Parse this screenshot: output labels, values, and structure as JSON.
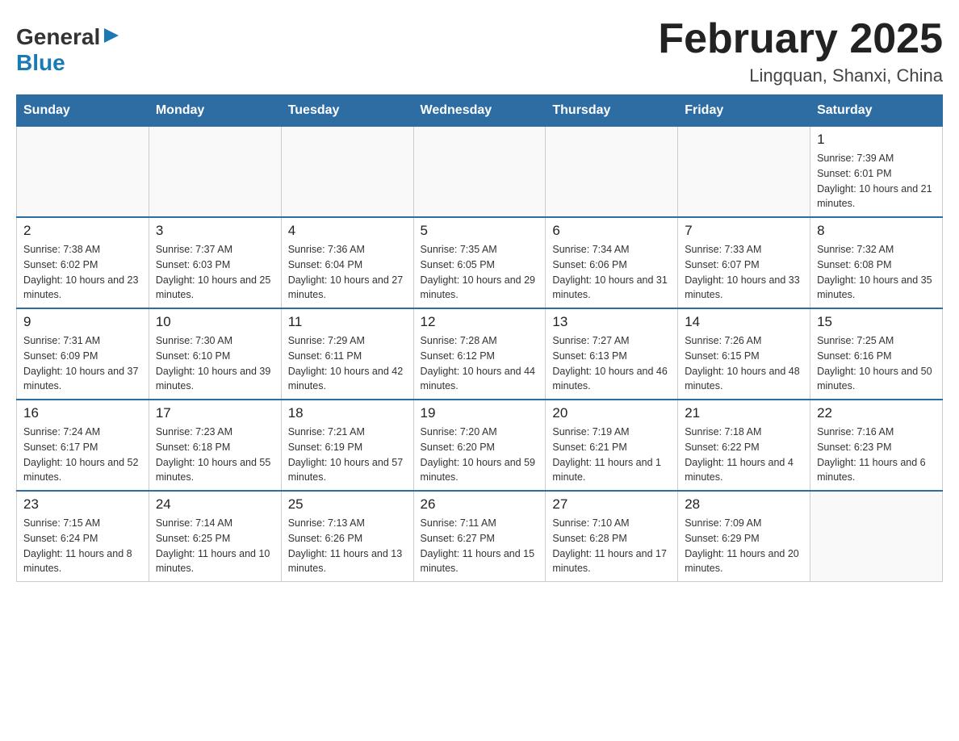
{
  "logo": {
    "general": "General",
    "blue": "Blue"
  },
  "title": {
    "month": "February 2025",
    "location": "Lingquan, Shanxi, China"
  },
  "days": {
    "headers": [
      "Sunday",
      "Monday",
      "Tuesday",
      "Wednesday",
      "Thursday",
      "Friday",
      "Saturday"
    ]
  },
  "weeks": [
    {
      "cells": [
        {
          "empty": true
        },
        {
          "empty": true
        },
        {
          "empty": true
        },
        {
          "empty": true
        },
        {
          "empty": true
        },
        {
          "empty": true
        },
        {
          "day": "1",
          "sunrise": "Sunrise: 7:39 AM",
          "sunset": "Sunset: 6:01 PM",
          "daylight": "Daylight: 10 hours and 21 minutes."
        }
      ]
    },
    {
      "cells": [
        {
          "day": "2",
          "sunrise": "Sunrise: 7:38 AM",
          "sunset": "Sunset: 6:02 PM",
          "daylight": "Daylight: 10 hours and 23 minutes."
        },
        {
          "day": "3",
          "sunrise": "Sunrise: 7:37 AM",
          "sunset": "Sunset: 6:03 PM",
          "daylight": "Daylight: 10 hours and 25 minutes."
        },
        {
          "day": "4",
          "sunrise": "Sunrise: 7:36 AM",
          "sunset": "Sunset: 6:04 PM",
          "daylight": "Daylight: 10 hours and 27 minutes."
        },
        {
          "day": "5",
          "sunrise": "Sunrise: 7:35 AM",
          "sunset": "Sunset: 6:05 PM",
          "daylight": "Daylight: 10 hours and 29 minutes."
        },
        {
          "day": "6",
          "sunrise": "Sunrise: 7:34 AM",
          "sunset": "Sunset: 6:06 PM",
          "daylight": "Daylight: 10 hours and 31 minutes."
        },
        {
          "day": "7",
          "sunrise": "Sunrise: 7:33 AM",
          "sunset": "Sunset: 6:07 PM",
          "daylight": "Daylight: 10 hours and 33 minutes."
        },
        {
          "day": "8",
          "sunrise": "Sunrise: 7:32 AM",
          "sunset": "Sunset: 6:08 PM",
          "daylight": "Daylight: 10 hours and 35 minutes."
        }
      ]
    },
    {
      "cells": [
        {
          "day": "9",
          "sunrise": "Sunrise: 7:31 AM",
          "sunset": "Sunset: 6:09 PM",
          "daylight": "Daylight: 10 hours and 37 minutes."
        },
        {
          "day": "10",
          "sunrise": "Sunrise: 7:30 AM",
          "sunset": "Sunset: 6:10 PM",
          "daylight": "Daylight: 10 hours and 39 minutes."
        },
        {
          "day": "11",
          "sunrise": "Sunrise: 7:29 AM",
          "sunset": "Sunset: 6:11 PM",
          "daylight": "Daylight: 10 hours and 42 minutes."
        },
        {
          "day": "12",
          "sunrise": "Sunrise: 7:28 AM",
          "sunset": "Sunset: 6:12 PM",
          "daylight": "Daylight: 10 hours and 44 minutes."
        },
        {
          "day": "13",
          "sunrise": "Sunrise: 7:27 AM",
          "sunset": "Sunset: 6:13 PM",
          "daylight": "Daylight: 10 hours and 46 minutes."
        },
        {
          "day": "14",
          "sunrise": "Sunrise: 7:26 AM",
          "sunset": "Sunset: 6:15 PM",
          "daylight": "Daylight: 10 hours and 48 minutes."
        },
        {
          "day": "15",
          "sunrise": "Sunrise: 7:25 AM",
          "sunset": "Sunset: 6:16 PM",
          "daylight": "Daylight: 10 hours and 50 minutes."
        }
      ]
    },
    {
      "cells": [
        {
          "day": "16",
          "sunrise": "Sunrise: 7:24 AM",
          "sunset": "Sunset: 6:17 PM",
          "daylight": "Daylight: 10 hours and 52 minutes."
        },
        {
          "day": "17",
          "sunrise": "Sunrise: 7:23 AM",
          "sunset": "Sunset: 6:18 PM",
          "daylight": "Daylight: 10 hours and 55 minutes."
        },
        {
          "day": "18",
          "sunrise": "Sunrise: 7:21 AM",
          "sunset": "Sunset: 6:19 PM",
          "daylight": "Daylight: 10 hours and 57 minutes."
        },
        {
          "day": "19",
          "sunrise": "Sunrise: 7:20 AM",
          "sunset": "Sunset: 6:20 PM",
          "daylight": "Daylight: 10 hours and 59 minutes."
        },
        {
          "day": "20",
          "sunrise": "Sunrise: 7:19 AM",
          "sunset": "Sunset: 6:21 PM",
          "daylight": "Daylight: 11 hours and 1 minute."
        },
        {
          "day": "21",
          "sunrise": "Sunrise: 7:18 AM",
          "sunset": "Sunset: 6:22 PM",
          "daylight": "Daylight: 11 hours and 4 minutes."
        },
        {
          "day": "22",
          "sunrise": "Sunrise: 7:16 AM",
          "sunset": "Sunset: 6:23 PM",
          "daylight": "Daylight: 11 hours and 6 minutes."
        }
      ]
    },
    {
      "cells": [
        {
          "day": "23",
          "sunrise": "Sunrise: 7:15 AM",
          "sunset": "Sunset: 6:24 PM",
          "daylight": "Daylight: 11 hours and 8 minutes."
        },
        {
          "day": "24",
          "sunrise": "Sunrise: 7:14 AM",
          "sunset": "Sunset: 6:25 PM",
          "daylight": "Daylight: 11 hours and 10 minutes."
        },
        {
          "day": "25",
          "sunrise": "Sunrise: 7:13 AM",
          "sunset": "Sunset: 6:26 PM",
          "daylight": "Daylight: 11 hours and 13 minutes."
        },
        {
          "day": "26",
          "sunrise": "Sunrise: 7:11 AM",
          "sunset": "Sunset: 6:27 PM",
          "daylight": "Daylight: 11 hours and 15 minutes."
        },
        {
          "day": "27",
          "sunrise": "Sunrise: 7:10 AM",
          "sunset": "Sunset: 6:28 PM",
          "daylight": "Daylight: 11 hours and 17 minutes."
        },
        {
          "day": "28",
          "sunrise": "Sunrise: 7:09 AM",
          "sunset": "Sunset: 6:29 PM",
          "daylight": "Daylight: 11 hours and 20 minutes."
        },
        {
          "empty": true
        }
      ]
    }
  ]
}
